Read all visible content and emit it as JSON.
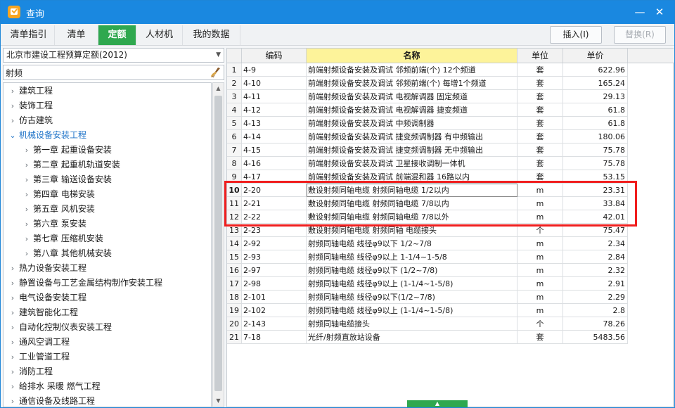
{
  "window": {
    "title": "查询",
    "minimize_label": "—",
    "close_label": "✕",
    "app_icon": "app-logo-icon",
    "accent_color": "#1a88e0"
  },
  "tabs": [
    {
      "label": "清单指引",
      "active": false
    },
    {
      "label": "清单",
      "active": false
    },
    {
      "label": "定额",
      "active": true
    },
    {
      "label": "人材机",
      "active": false
    },
    {
      "label": "我的数据",
      "active": false
    }
  ],
  "actions": {
    "insert_label": "插入(I)",
    "replace_label": "替换(R)"
  },
  "left_panel": {
    "library_select": "北京市建设工程预算定额(2012)",
    "search_value": "射频",
    "search_icon": "broom-clear-icon",
    "tree": [
      {
        "label": "建筑工程",
        "level": 0,
        "expanded": false,
        "selected": false
      },
      {
        "label": "装饰工程",
        "level": 0,
        "expanded": false,
        "selected": false
      },
      {
        "label": "仿古建筑",
        "level": 0,
        "expanded": false,
        "selected": false
      },
      {
        "label": "机械设备安装工程",
        "level": 0,
        "expanded": true,
        "selected": true
      },
      {
        "label": "第一章  起重设备安装",
        "level": 1,
        "expanded": false,
        "selected": false
      },
      {
        "label": "第二章  起重机轨道安装",
        "level": 1,
        "expanded": false,
        "selected": false
      },
      {
        "label": "第三章  输送设备安装",
        "level": 1,
        "expanded": false,
        "selected": false
      },
      {
        "label": "第四章  电梯安装",
        "level": 1,
        "expanded": false,
        "selected": false
      },
      {
        "label": "第五章  风机安装",
        "level": 1,
        "expanded": false,
        "selected": false
      },
      {
        "label": "第六章  泵安装",
        "level": 1,
        "expanded": false,
        "selected": false
      },
      {
        "label": "第七章  压缩机安装",
        "level": 1,
        "expanded": false,
        "selected": false
      },
      {
        "label": "第八章  其他机械安装",
        "level": 1,
        "expanded": false,
        "selected": false
      },
      {
        "label": "热力设备安装工程",
        "level": 0,
        "expanded": false,
        "selected": false
      },
      {
        "label": "静置设备与工艺金属结构制作安装工程",
        "level": 0,
        "expanded": false,
        "selected": false
      },
      {
        "label": "电气设备安装工程",
        "level": 0,
        "expanded": false,
        "selected": false
      },
      {
        "label": "建筑智能化工程",
        "level": 0,
        "expanded": false,
        "selected": false
      },
      {
        "label": "自动化控制仪表安装工程",
        "level": 0,
        "expanded": false,
        "selected": false
      },
      {
        "label": "通风空调工程",
        "level": 0,
        "expanded": false,
        "selected": false
      },
      {
        "label": "工业管道工程",
        "level": 0,
        "expanded": false,
        "selected": false
      },
      {
        "label": "消防工程",
        "level": 0,
        "expanded": false,
        "selected": false
      },
      {
        "label": "给排水  采暖  燃气工程",
        "level": 0,
        "expanded": false,
        "selected": false
      },
      {
        "label": "通信设备及线路工程",
        "level": 0,
        "expanded": false,
        "selected": false
      }
    ]
  },
  "grid": {
    "columns": [
      "编码",
      "名称",
      "单位",
      "单价"
    ],
    "sorted_column": "名称",
    "rows": [
      {
        "idx": "1",
        "code": "4-9",
        "name": "前端射频设备安装及调试  邻频前端(个)  12个频道",
        "unit": "套",
        "price": "622.96"
      },
      {
        "idx": "2",
        "code": "4-10",
        "name": "前端射频设备安装及调试  邻频前端(个)  每增1个频道",
        "unit": "套",
        "price": "165.24"
      },
      {
        "idx": "3",
        "code": "4-11",
        "name": "前端射频设备安装及调试  电视解调器  固定频道",
        "unit": "套",
        "price": "29.13"
      },
      {
        "idx": "4",
        "code": "4-12",
        "name": "前端射频设备安装及调试  电视解调器  捷变频道",
        "unit": "套",
        "price": "61.8"
      },
      {
        "idx": "5",
        "code": "4-13",
        "name": "前端射频设备安装及调试  中频调制器",
        "unit": "套",
        "price": "61.8"
      },
      {
        "idx": "6",
        "code": "4-14",
        "name": "前端射频设备安装及调试  捷变频调制器  有中频输出",
        "unit": "套",
        "price": "180.06"
      },
      {
        "idx": "7",
        "code": "4-15",
        "name": "前端射频设备安装及调试  捷变频调制器  无中频输出",
        "unit": "套",
        "price": "75.78"
      },
      {
        "idx": "8",
        "code": "4-16",
        "name": "前端射频设备安装及调试  卫星接收调制一体机",
        "unit": "套",
        "price": "75.78"
      },
      {
        "idx": "9",
        "code": "4-17",
        "name": "前端射频设备安装及调试  前端混和器  16路以内",
        "unit": "套",
        "price": "53.15"
      },
      {
        "idx": "10",
        "code": "2-20",
        "name": "敷设射频同轴电缆  射频同轴电缆  1/2以内",
        "unit": "m",
        "price": "23.31",
        "selected": true
      },
      {
        "idx": "11",
        "code": "2-21",
        "name": "敷设射频同轴电缆  射频同轴电缆  7/8以内",
        "unit": "m",
        "price": "33.84"
      },
      {
        "idx": "12",
        "code": "2-22",
        "name": "敷设射频同轴电缆  射频同轴电缆  7/8以外",
        "unit": "m",
        "price": "42.01"
      },
      {
        "idx": "13",
        "code": "2-23",
        "name": "敷设射频同轴电缆  射频同轴  电缆接头",
        "unit": "个",
        "price": "75.47"
      },
      {
        "idx": "14",
        "code": "2-92",
        "name": "射频同轴电缆  线径φ9以下  1/2~7/8",
        "unit": "m",
        "price": "2.34"
      },
      {
        "idx": "15",
        "code": "2-93",
        "name": "射频同轴电缆  线径φ9以上  1-1/4~1-5/8",
        "unit": "m",
        "price": "2.84"
      },
      {
        "idx": "16",
        "code": "2-97",
        "name": "射频同轴电缆  线径φ9以下  (1/2~7/8)",
        "unit": "m",
        "price": "2.32"
      },
      {
        "idx": "17",
        "code": "2-98",
        "name": "射频同轴电缆  线径φ9以上  (1-1/4~1-5/8)",
        "unit": "m",
        "price": "2.91"
      },
      {
        "idx": "18",
        "code": "2-101",
        "name": "射频同轴电缆  线径φ9以下(1/2~7/8)",
        "unit": "m",
        "price": "2.29"
      },
      {
        "idx": "19",
        "code": "2-102",
        "name": "射频同轴电缆  线径φ9以上  (1-1/4~1-5/8)",
        "unit": "m",
        "price": "2.8"
      },
      {
        "idx": "20",
        "code": "2-143",
        "name": "射频同轴电缆接头",
        "unit": "个",
        "price": "78.26"
      },
      {
        "idx": "21",
        "code": "7-18",
        "name": "光纤/射频直放站设备",
        "unit": "套",
        "price": "5483.56"
      }
    ]
  },
  "colors": {
    "active_tab": "#2fa84f",
    "sorted_header": "#fdf39a",
    "highlight_border": "#f01e1e",
    "selected_tree": "#1e73c8"
  }
}
